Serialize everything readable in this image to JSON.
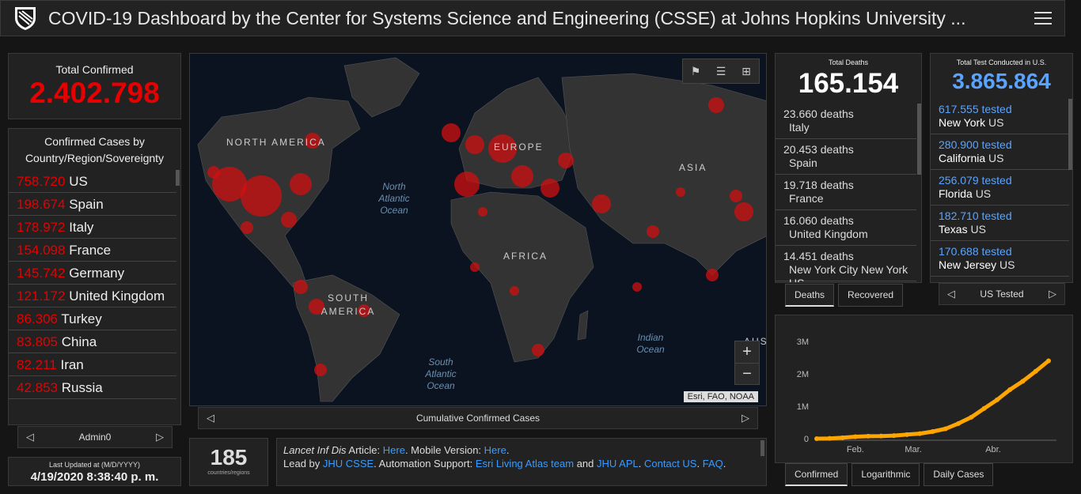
{
  "header": {
    "title": "COVID-19 Dashboard by the Center for Systems Science and Engineering (CSSE) at Johns Hopkins University ...",
    "menu_icon": "hamburger-menu-icon",
    "logo_icon": "jhu-shield-icon"
  },
  "total_confirmed": {
    "label": "Total Confirmed",
    "value": "2.402.798"
  },
  "country_panel": {
    "title": "Confirmed Cases by Country/Region/Sovereignty",
    "items": [
      {
        "num": "758.720",
        "name": "US"
      },
      {
        "num": "198.674",
        "name": "Spain"
      },
      {
        "num": "178.972",
        "name": "Italy"
      },
      {
        "num": "154.098",
        "name": "France"
      },
      {
        "num": "145.742",
        "name": "Germany"
      },
      {
        "num": "121.172",
        "name": "United Kingdom"
      },
      {
        "num": "86.306",
        "name": "Turkey"
      },
      {
        "num": "83.805",
        "name": "China"
      },
      {
        "num": "82.211",
        "name": "Iran"
      },
      {
        "num": "42.853",
        "name": "Russia"
      }
    ],
    "pager_label": "Admin0"
  },
  "last_updated": {
    "label": "Last Updated at (M/D/YYYY)",
    "value": "4/19/2020 8:38:40 p. m."
  },
  "map": {
    "labels": {
      "north_america": "NORTH AMERICA",
      "europe": "EUROPE",
      "asia": "ASIA",
      "africa": "AFRICA",
      "south_america": "SOUTH AMERICA",
      "australia": "AUS"
    },
    "oceans": {
      "north_atlantic": "North Atlantic Ocean",
      "south_atlantic": "South Atlantic Ocean",
      "indian": "Indian Ocean"
    },
    "attribution": "Esri, FAO, NOAA",
    "zoom_in": "+",
    "zoom_out": "−",
    "pager_label": "Cumulative Confirmed Cases"
  },
  "count": {
    "value": "185",
    "label": "countries/regions"
  },
  "info": {
    "lancet": "Lancet Inf Dis",
    "article_text": " Article: ",
    "here": "Here",
    "mobile_text": ". Mobile Version: ",
    "mobile_here": "Here",
    "period": ".",
    "lead_by": "Lead by ",
    "jhu_csse": "JHU CSSE",
    "automation": ". Automation Support: ",
    "esri_team": "Esri Living Atlas team",
    "and": " and ",
    "jhu_apl": "JHU APL",
    "contact_sep": ". ",
    "contact": "Contact US",
    "faq_sep": ". ",
    "faq": "FAQ",
    "end": "."
  },
  "deaths": {
    "label": "Total Deaths",
    "value": "165.154",
    "items": [
      {
        "num": "23.660 deaths",
        "loc": "Italy"
      },
      {
        "num": "20.453 deaths",
        "loc": "Spain"
      },
      {
        "num": "19.718 deaths",
        "loc": "France"
      },
      {
        "num": "16.060 deaths",
        "loc": "United Kingdom"
      },
      {
        "num": "14.451 deaths",
        "loc": "New York City New York US"
      }
    ],
    "tabs": [
      "Deaths",
      "Recovered"
    ]
  },
  "tests": {
    "label": "Total Test Conducted in U.S.",
    "value": "3.865.864",
    "items": [
      {
        "num": "617.555 tested",
        "state": "New York",
        "country": "US"
      },
      {
        "num": "280.900 tested",
        "state": "California",
        "country": "US"
      },
      {
        "num": "256.079 tested",
        "state": "Florida",
        "country": "US"
      },
      {
        "num": "182.710 tested",
        "state": "Texas",
        "country": "US"
      },
      {
        "num": "170.688 tested",
        "state": "New Jersey",
        "country": "US"
      }
    ],
    "pager_label": "US Tested"
  },
  "chart_tabs": [
    "Confirmed",
    "Logarithmic",
    "Daily Cases"
  ],
  "colors": {
    "accent_red": "#e60000",
    "accent_blue": "#5aa4ff",
    "chart_orange": "#ffa500"
  },
  "chart_data": {
    "type": "line",
    "title": "",
    "xlabel": "",
    "ylabel": "",
    "ylim": [
      0,
      3000000
    ],
    "y_ticks": [
      "0",
      "1M",
      "2M",
      "3M"
    ],
    "x_ticks": [
      "Feb.",
      "Mar.",
      "Abr."
    ],
    "series": [
      {
        "x": [
          "1/22",
          "1/29",
          "2/5",
          "2/12",
          "2/19",
          "2/26",
          "3/4",
          "3/11",
          "3/14",
          "3/18",
          "3/21",
          "3/25",
          "3/28",
          "4/1",
          "4/4",
          "4/8",
          "4/11",
          "4/15",
          "4/19"
        ],
        "values": [
          555,
          7783,
          28276,
          60363,
          75641,
          81397,
          95124,
          126214,
          156653,
          218822,
          304635,
          467594,
          660706,
          932605,
          1197405,
          1511104,
          1771514,
          2078605,
          2402798
        ]
      }
    ]
  }
}
